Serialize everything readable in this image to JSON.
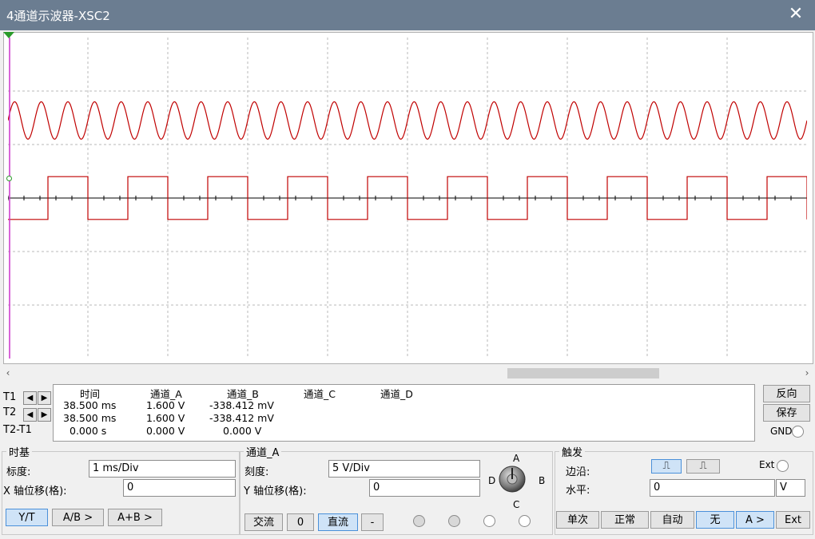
{
  "window": {
    "title": "4通道示波器-XSC2",
    "close_icon": "close-icon"
  },
  "scope": {
    "background": "#ffffff",
    "grid_color": "#b8b8b8",
    "trace_color": "#c00000",
    "marker_color": "#cc33cc",
    "channel_a": {
      "type": "sine",
      "periods_on_screen": 30,
      "amplitude_div": 0.35,
      "offset_div": 1
    },
    "channel_b": {
      "type": "square",
      "periods_on_screen": 10,
      "high_div": 0.4,
      "low_div": -0.4,
      "offset_div": 0
    }
  },
  "scroll": {
    "left_arrow": "‹",
    "right_arrow": "›"
  },
  "cursors": {
    "rows": [
      {
        "label": "T1"
      },
      {
        "label": "T2"
      },
      {
        "label": "T2-T1"
      }
    ]
  },
  "readout": {
    "headers": [
      "时间",
      "通道_A",
      "通道_B",
      "通道_C",
      "通道_D"
    ],
    "rows": [
      [
        "38.500 ms",
        "1.600 V",
        "-338.412 mV",
        "",
        ""
      ],
      [
        "38.500 ms",
        "1.600 V",
        "-338.412 mV",
        "",
        ""
      ],
      [
        "0.000 s",
        "0.000 V",
        "0.000 V",
        "",
        ""
      ]
    ]
  },
  "side_buttons": {
    "reverse": "反向",
    "save": "保存",
    "gnd": "GND"
  },
  "timebase": {
    "title": "时基",
    "scale_label": "标度:",
    "scale_value": "1 ms/Div",
    "xpos_label": "X 轴位移(格):",
    "xpos_value": "0",
    "buttons": [
      "Y/T",
      "A/B >",
      "A+B >"
    ]
  },
  "channel": {
    "title": "通道_A",
    "scale_label": "刻度:",
    "scale_value": "5  V/Div",
    "ypos_label": "Y 轴位移(格):",
    "ypos_value": "0",
    "coupling": [
      "交流",
      "0",
      "直流",
      "-"
    ],
    "knob_labels": {
      "top": "A",
      "right": "B",
      "bottom": "C",
      "left": "D"
    }
  },
  "trigger": {
    "title": "触发",
    "edge_label": "边沿:",
    "level_label": "水平:",
    "level_value": "0",
    "level_unit": "V",
    "ext_label": "Ext",
    "modes": [
      "单次",
      "正常",
      "自动",
      "无",
      "A >",
      "Ext"
    ]
  }
}
